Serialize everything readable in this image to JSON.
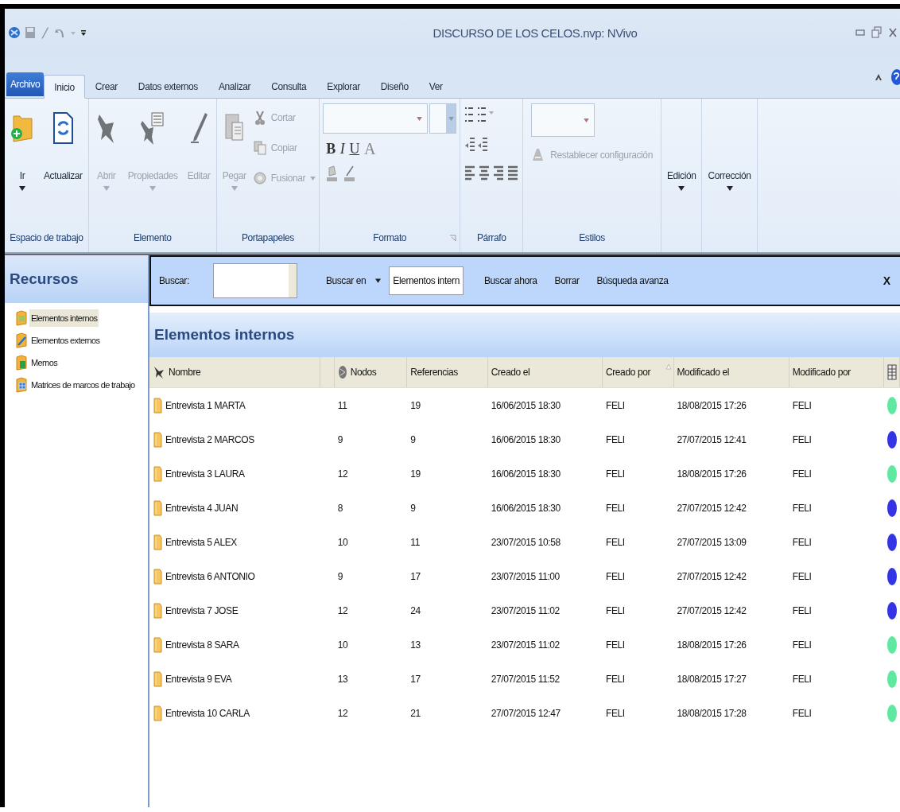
{
  "window": {
    "title": "DISCURSO DE LOS CELOS.nvp: NVivo"
  },
  "ribbon_tabs": [
    {
      "label": "Archivo",
      "kind": "file",
      "selected": false
    },
    {
      "label": "Inicio",
      "kind": "tab",
      "selected": true
    },
    {
      "label": "Crear",
      "kind": "tab",
      "selected": false
    },
    {
      "label": "Datos externos",
      "kind": "tab",
      "selected": false
    },
    {
      "label": "Analizar",
      "kind": "tab",
      "selected": false
    },
    {
      "label": "Consulta",
      "kind": "tab",
      "selected": false
    },
    {
      "label": "Explorar",
      "kind": "tab",
      "selected": false
    },
    {
      "label": "Diseño",
      "kind": "tab",
      "selected": false
    },
    {
      "label": "Ver",
      "kind": "tab",
      "selected": false
    }
  ],
  "ribbon_groups": [
    {
      "label": "Espacio de trabajo",
      "kind": "large",
      "items": [
        {
          "label": "Ir",
          "dropdown": true,
          "disabled": false
        },
        {
          "label": "Actualizar",
          "dropdown": false,
          "disabled": false
        }
      ]
    },
    {
      "label": "Elemento",
      "kind": "large",
      "items": [
        {
          "label": "Abrir",
          "dropdown": true,
          "disabled": true
        },
        {
          "label": "Propiedades",
          "dropdown": true,
          "disabled": true
        },
        {
          "label": "Editar",
          "dropdown": false,
          "disabled": true
        }
      ]
    },
    {
      "label": "Portapapeles",
      "kind": "clipboard",
      "items": [
        {
          "label": "Pegar",
          "dropdown": true,
          "disabled": true
        },
        {
          "label": "Cortar",
          "dropdown": false,
          "disabled": true
        },
        {
          "label": "Copiar",
          "dropdown": false,
          "disabled": true
        },
        {
          "label": "Fusionar",
          "dropdown": true,
          "disabled": true
        }
      ]
    },
    {
      "label": "Formato",
      "kind": "format",
      "launcher": true,
      "glyphs": [
        "B",
        "I",
        "U",
        "A"
      ]
    },
    {
      "label": "Párrafo",
      "kind": "paragraph"
    },
    {
      "label": "Estilos",
      "kind": "styles",
      "items": [
        {
          "label": "Restablecer configuración",
          "disabled": true
        }
      ]
    },
    {
      "kind": "menu",
      "items": [
        {
          "label": "Edición",
          "dropdown": true,
          "disabled": false
        }
      ]
    },
    {
      "kind": "menu",
      "items": [
        {
          "label": "Corrección",
          "dropdown": true,
          "disabled": false
        }
      ]
    }
  ],
  "sidebar": {
    "title": "Recursos",
    "items": [
      {
        "label": "Elementos internos",
        "selected": true
      },
      {
        "label": "Elementos externos",
        "selected": false
      },
      {
        "label": "Memos",
        "selected": false
      },
      {
        "label": "Matrices de marcos de trabajo",
        "selected": false
      }
    ]
  },
  "search_bar": {
    "label": "Buscar:",
    "scope_button": "Buscar en",
    "scope_value": "Elementos intern",
    "buttons": [
      "Buscar ahora",
      "Borrar",
      "Búsqueda avanza"
    ],
    "close": "X"
  },
  "list_title": "Elementos internos",
  "table": {
    "columns": [
      {
        "label": "Nombre",
        "sorted": false
      },
      {
        "label": "Nodos",
        "sorted": false
      },
      {
        "label": "Referencias",
        "sorted": false
      },
      {
        "label": "Creado el",
        "sorted": false
      },
      {
        "label": "Creado por",
        "sorted": true
      },
      {
        "label": "Modificado el",
        "sorted": false
      },
      {
        "label": "Modificado por",
        "sorted": false
      }
    ],
    "rows": [
      {
        "cells": [
          "Entrevista 1 MARTA",
          "11",
          "19",
          "16/06/2015 18:30",
          "FELI",
          "18/08/2015 17:26",
          "FELI"
        ],
        "color": "#5ee8a0"
      },
      {
        "cells": [
          "Entrevista 2 MARCOS",
          "9",
          "9",
          "16/06/2015 18:30",
          "FELI",
          "27/07/2015 12:41",
          "FELI"
        ],
        "color": "#3434e6"
      },
      {
        "cells": [
          "Entrevista 3 LAURA",
          "12",
          "19",
          "16/06/2015 18:30",
          "FELI",
          "18/08/2015 17:26",
          "FELI"
        ],
        "color": "#5ee8a0"
      },
      {
        "cells": [
          "Entrevista 4 JUAN",
          "8",
          "9",
          "16/06/2015 18:30",
          "FELI",
          "27/07/2015 12:42",
          "FELI"
        ],
        "color": "#3434e6"
      },
      {
        "cells": [
          "Entrevista 5 ALEX",
          "10",
          "11",
          "23/07/2015 10:58",
          "FELI",
          "27/07/2015 13:09",
          "FELI"
        ],
        "color": "#3434e6"
      },
      {
        "cells": [
          "Entrevista 6 ANTONIO",
          "9",
          "17",
          "23/07/2015 11:00",
          "FELI",
          "27/07/2015 12:42",
          "FELI"
        ],
        "color": "#3434e6"
      },
      {
        "cells": [
          "Entrevista 7 JOSE",
          "12",
          "24",
          "23/07/2015 11:02",
          "FELI",
          "27/07/2015 12:42",
          "FELI"
        ],
        "color": "#3434e6"
      },
      {
        "cells": [
          "Entrevista 8 SARA",
          "10",
          "13",
          "23/07/2015 11:02",
          "FELI",
          "18/08/2015 17:26",
          "FELI"
        ],
        "color": "#5ee8a0"
      },
      {
        "cells": [
          "Entrevista 9 EVA",
          "13",
          "17",
          "27/07/2015 11:52",
          "FELI",
          "18/08/2015 17:27",
          "FELI"
        ],
        "color": "#5ee8a0"
      },
      {
        "cells": [
          "Entrevista 10 CARLA",
          "12",
          "21",
          "27/07/2015 12:47",
          "FELI",
          "18/08/2015 17:28",
          "FELI"
        ],
        "color": "#5ee8a0"
      }
    ]
  }
}
